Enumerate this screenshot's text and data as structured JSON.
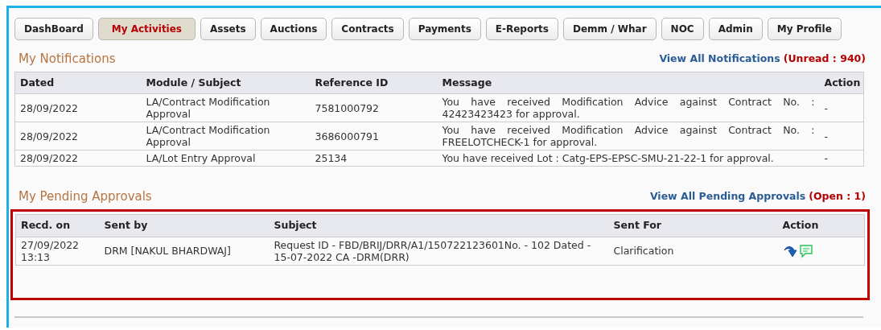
{
  "tabs": [
    {
      "label": "DashBoard",
      "selected": false
    },
    {
      "label": "My Activities",
      "selected": true
    },
    {
      "label": "Assets",
      "selected": false
    },
    {
      "label": "Auctions",
      "selected": false
    },
    {
      "label": "Contracts",
      "selected": false
    },
    {
      "label": "Payments",
      "selected": false
    },
    {
      "label": "E-Reports",
      "selected": false
    },
    {
      "label": "Demm / Whar",
      "selected": false
    },
    {
      "label": "NOC",
      "selected": false
    },
    {
      "label": "Admin",
      "selected": false
    },
    {
      "label": "My Profile",
      "selected": false
    }
  ],
  "notifications": {
    "title": "My Notifications",
    "link": "View All Notifications",
    "count": "(Unread : 940)",
    "table": {
      "columns": [
        "Dated",
        "Module / Subject",
        "Reference ID",
        "Message",
        "Action"
      ],
      "rows": [
        [
          "28/09/2022",
          "LA/Contract Modification Approval",
          "7581000792",
          "You have received Modification Advice against Contract No. : 42423423423 for approval.",
          "-"
        ],
        [
          "28/09/2022",
          "LA/Contract Modification Approval",
          "3686000791",
          "You have received Modification Advice against Contract No. : FREELOTCHECK-1 for approval.",
          "-"
        ],
        [
          "28/09/2022",
          "LA/Lot Entry Approval",
          "25134",
          "You have received Lot : Catg-EPS-EPSC-SMU-21-22-1 for approval.",
          "-"
        ]
      ]
    }
  },
  "pending_approvals": {
    "title": "My Pending Approvals",
    "link": "View All Pending Approvals",
    "count": "(Open : 1)",
    "highlighted": true,
    "table": {
      "columns": [
        "Recd. on",
        "Sent by",
        "Subject",
        "Sent For",
        "Action"
      ],
      "rows": [
        {
          "recd_on": "27/09/2022 13:13",
          "sent_by": "DRM [NAKUL BHARDWAJ]",
          "subject": "Request ID - FBD/BRIJ/DRR/A1/150722123601No. - 102 Dated - 15-07-2022 CA -DRM(DRR)",
          "sent_for": "Clarification"
        }
      ]
    }
  }
}
